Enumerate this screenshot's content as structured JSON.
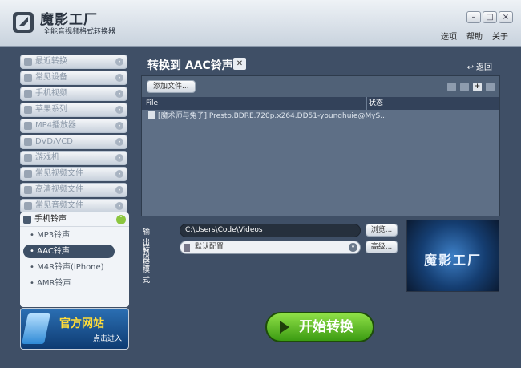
{
  "app": {
    "title": "魔影工厂",
    "subtitle": "全能音视频格式转换器",
    "menu": [
      "选项",
      "帮助",
      "关于"
    ],
    "window_buttons": [
      "–",
      "□",
      "×"
    ]
  },
  "sidebar": {
    "categories": [
      {
        "label": "最近转换",
        "icon": "clock-icon"
      },
      {
        "label": "常见设备",
        "icon": "device-icon"
      },
      {
        "label": "手机视频",
        "icon": "phone-icon"
      },
      {
        "label": "苹果系列",
        "icon": "apple-icon"
      },
      {
        "label": "MP4播放器",
        "icon": "mp4-icon"
      },
      {
        "label": "DVD/VCD",
        "icon": "disc-icon"
      },
      {
        "label": "游戏机",
        "icon": "gamepad-icon"
      },
      {
        "label": "常见视频文件",
        "icon": "video-file-icon"
      },
      {
        "label": "高清视频文件",
        "icon": "hd-file-icon"
      },
      {
        "label": "常见音频文件",
        "icon": "audio-file-icon"
      }
    ],
    "open_category": {
      "label": "手机铃声",
      "items": [
        "MP3铃声",
        "AAC铃声",
        "M4R铃声(iPhone)",
        "AMR铃声"
      ],
      "active_index": 1
    },
    "banner": {
      "title": "官方网站",
      "subtitle": "点击进入"
    }
  },
  "main": {
    "heading": "转换到 AAC铃声",
    "back_label": "返回",
    "add_file_label": "添加文件...",
    "columns": [
      "File",
      "状态"
    ],
    "files": [
      {
        "name": "[魔术师与兔子].Presto.BDRE.720p.x264.DD51-younghuie@MyS...",
        "status": ""
      }
    ],
    "output_label": "输出路径:",
    "output_path": "C:\\Users\\Code\\Videos",
    "browse_label": "浏览...",
    "mode_label": "转换模式:",
    "mode_value": "默认配置",
    "advanced_label": "高级...",
    "preview_text": "魔影工厂",
    "start_label": "开始转换"
  }
}
